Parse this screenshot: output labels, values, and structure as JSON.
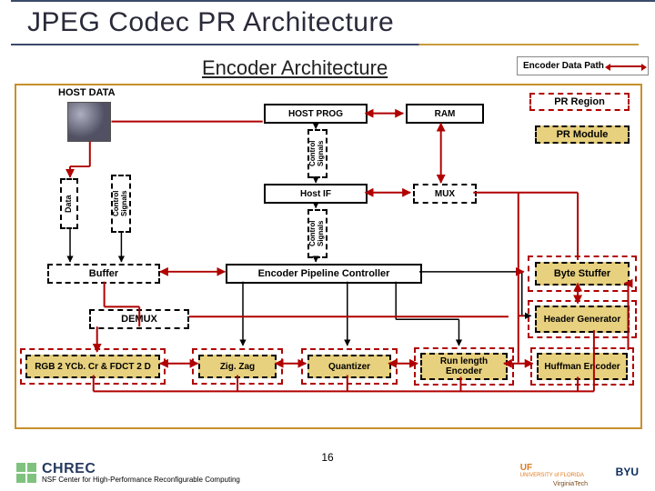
{
  "title": "JPEG Codec PR Architecture",
  "subtitle": "Encoder Architecture",
  "legend": {
    "datapath": "Encoder Data Path",
    "pr_region": "PR Region",
    "pr_module": "PR Module"
  },
  "labels": {
    "host_data": "HOST DATA",
    "host_prog": "HOST PROG",
    "ram": "RAM",
    "host_if": "Host IF",
    "mux": "MUX",
    "epc": "Encoder Pipeline Controller",
    "byte_stuffer": "Byte Stuffer",
    "buffer": "Buffer",
    "demux": "DEMUX",
    "header_gen": "Header Generator",
    "rgb_fdct": "RGB 2 YCb. Cr & FDCT 2 D",
    "zigzag": "Zig. Zag",
    "quantizer": "Quantizer",
    "rle": "Run length Encoder",
    "huffman": "Huffman Encoder",
    "data": "Data",
    "ctrl": "Control Signals"
  },
  "footer": {
    "page": "16",
    "chrec_name": "CHREC",
    "chrec_sub": "NSF Center for High-Performance Reconfigurable Computing",
    "uf": "UF",
    "uf_sub": "UNIVERSITY of FLORIDA",
    "byu": "BYU",
    "vt": "VirginiaTech"
  }
}
